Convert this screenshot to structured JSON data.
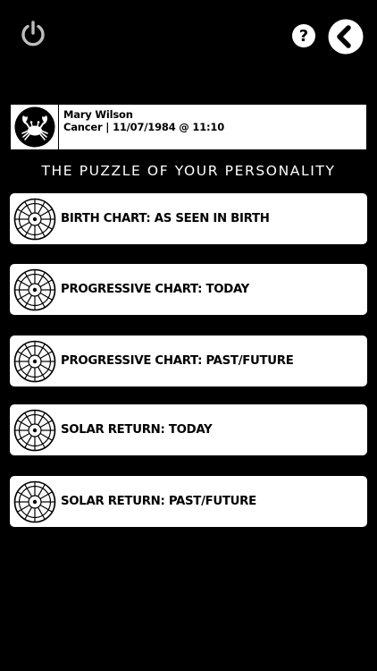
{
  "profile": {
    "name": "Mary Wilson",
    "details": "Cancer | 11/07/1984 @ 11:10",
    "avatar_icon": "crab-icon"
  },
  "section_title": "THE PUZZLE OF YOUR PERSONALITY",
  "menu": {
    "items": [
      {
        "label": "BIRTH CHART: AS SEEN IN BIRTH",
        "icon": "chart-wheel-icon"
      },
      {
        "label": "PROGRESSIVE CHART: TODAY",
        "icon": "chart-wheel-icon"
      },
      {
        "label": "PROGRESSIVE CHART: PAST/FUTURE",
        "icon": "chart-wheel-icon"
      },
      {
        "label": "SOLAR RETURN: TODAY",
        "icon": "chart-wheel-icon"
      },
      {
        "label": "SOLAR RETURN: PAST/FUTURE",
        "icon": "chart-wheel-icon"
      }
    ]
  },
  "toolbar": {
    "power_icon": "power-icon",
    "help_icon": "help-icon",
    "back_icon": "back-icon"
  },
  "colors": {
    "background": "#000000",
    "card": "#ffffff",
    "icon_gray": "#bdbdbd"
  }
}
